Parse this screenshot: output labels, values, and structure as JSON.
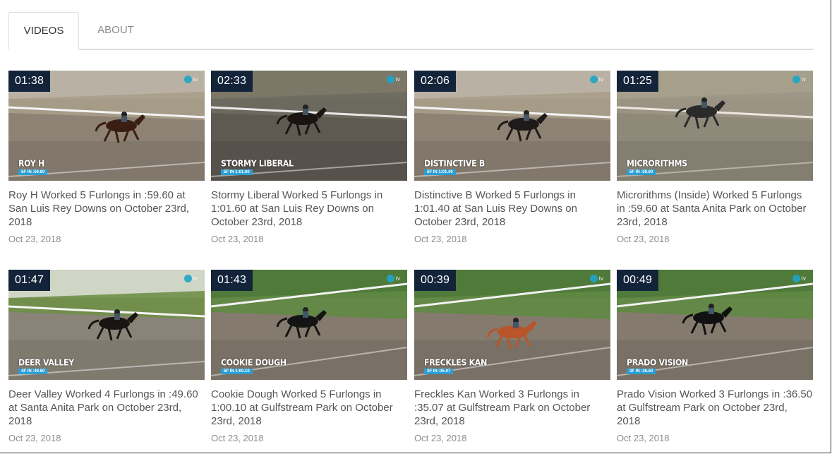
{
  "tabs": {
    "videos_label": "VIDEOS",
    "about_label": "ABOUT"
  },
  "brand_logo_text": "tv",
  "videos": [
    {
      "duration": "01:38",
      "overlay_name": "ROY H",
      "overlay_time": "5F IN :59.60",
      "title": "Roy H Worked 5 Furlongs in :59.60 at San Luis Rey Downs on October 23rd, 2018",
      "date": "Oct 23, 2018",
      "scene": "dirt",
      "horse_color": "#3a1e12"
    },
    {
      "duration": "02:33",
      "overlay_name": "STORMY LIBERAL",
      "overlay_time": "5F IN 1:01.60",
      "title": "Stormy Liberal Worked 5 Furlongs in 1:01.60 at San Luis Rey Downs on October 23rd, 2018",
      "date": "Oct 23, 2018",
      "scene": "dark-dirt",
      "horse_color": "#1c1410"
    },
    {
      "duration": "02:06",
      "overlay_name": "DISTINCTIVE B",
      "overlay_time": "5F IN 1:01.40",
      "title": "Distinctive B Worked 5 Furlongs in 1:01.40 at San Luis Rey Downs on October 23rd, 2018",
      "date": "Oct 23, 2018",
      "scene": "dirt",
      "horse_color": "#1f1a1a"
    },
    {
      "duration": "01:25",
      "overlay_name": "MICRORITHMS",
      "overlay_time": "5F IN :59.60",
      "title": "Microrithms (Inside) Worked 5 Furlongs in :59.60 at Santa Anita Park on October 23rd, 2018",
      "date": "Oct 23, 2018",
      "scene": "hazy",
      "horse_color": "#2a2a2a"
    },
    {
      "duration": "01:47",
      "overlay_name": "DEER VALLEY",
      "overlay_time": "4F IN :49.60",
      "title": "Deer Valley Worked 4 Furlongs in :49.60 at Santa Anita Park on October 23rd, 2018",
      "date": "Oct 23, 2018",
      "scene": "green",
      "horse_color": "#1a1412"
    },
    {
      "duration": "01:43",
      "overlay_name": "COOKIE DOUGH",
      "overlay_time": "5F IN 1:00.10",
      "title": "Cookie Dough Worked 5 Furlongs in 1:00.10 at Gulfstream Park on October 23rd, 2018",
      "date": "Oct 23, 2018",
      "scene": "gulf",
      "horse_color": "#141414"
    },
    {
      "duration": "00:39",
      "overlay_name": "FRECKLES KAN",
      "overlay_time": "3F IN :35.07",
      "title": "Freckles Kan Worked 3 Furlongs in :35.07 at Gulfstream Park on October 23rd, 2018",
      "date": "Oct 23, 2018",
      "scene": "gulf",
      "horse_color": "#b8552a"
    },
    {
      "duration": "00:49",
      "overlay_name": "PRADO VISION",
      "overlay_time": "3F IN :36.50",
      "title": "Prado Vision Worked 3 Furlongs in :36.50 at Gulfstream Park on October 23rd, 2018",
      "date": "Oct 23, 2018",
      "scene": "gulf",
      "horse_color": "#111111"
    }
  ]
}
